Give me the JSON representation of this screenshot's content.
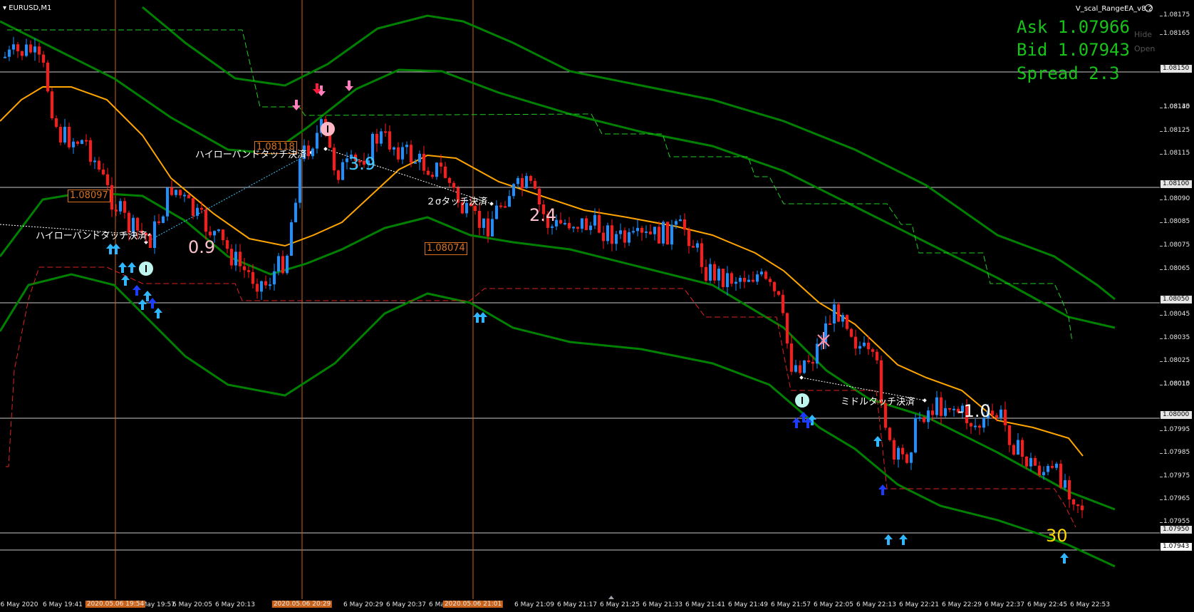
{
  "window": {
    "symbol_label": "EURUSD,M1",
    "ea_label": "V_scal_RangeEA_v8.2"
  },
  "quote": {
    "ask": "Ask 1.07966",
    "bid": "Bid 1.07943",
    "spread": "Spread 2.3"
  },
  "side_buttons": {
    "hide": "Hide",
    "open": "Open"
  },
  "price_axis": {
    "labels": [
      "1.08175",
      "1.08165",
      "1.08140",
      "1.08135",
      "1.08125",
      "1.08115",
      "1.08090",
      "1.08085",
      "1.08075",
      "1.08065",
      "1.08045",
      "1.08035",
      "1.08025",
      "1.08015",
      "1.08010",
      "1.07995",
      "1.07985",
      "1.07975",
      "1.07965",
      "1.07955"
    ],
    "boxes": {
      "p1": "1.08150",
      "p2": "1.08100",
      "p3": "1.08050",
      "p4": "1.08000",
      "p5": "1.07950",
      "current": "1.07943"
    }
  },
  "time_axis": {
    "labels": [
      "6 May 2020",
      "6 May 19:41",
      "6 May 19:57",
      "6 May 20:05",
      "6 May 20:13",
      "6 May 20:29",
      "6 May 20:37",
      "6 May 20:45",
      "6 May 21:09",
      "6 May 21:17",
      "6 May 21:25",
      "6 May 21:33",
      "6 May 21:41",
      "6 May 21:49",
      "6 May 21:57",
      "6 May 22:05",
      "6 May 22:13",
      "6 May 22:21",
      "6 May 22:29",
      "6 May 22:37",
      "6 May 22:45",
      "6 May 22:53"
    ],
    "highlights": [
      "2020.05.06 19:54",
      "2020.05.06 20:29",
      "2020.05.06 21:01"
    ]
  },
  "price_boxes": [
    "1.08097",
    "1.08118",
    "1.08074"
  ],
  "annotations": [
    "ハイローバンドタッチ決済",
    "ハイローバンドタッチ決済",
    "２σタッチ決済",
    "ミドルタッチ決済"
  ],
  "profits": [
    "0.9",
    "3.9",
    "2.4",
    "-1.0"
  ],
  "counter": "30",
  "colors": {
    "bull": "#1e8fff",
    "bear": "#ff1a1a",
    "ma": "#ffa500",
    "band": "#008000",
    "dashed_green": "#22cc22",
    "dashed_red": "#dd2222",
    "quote": "#19c21a",
    "vline": "#c9621a"
  }
}
